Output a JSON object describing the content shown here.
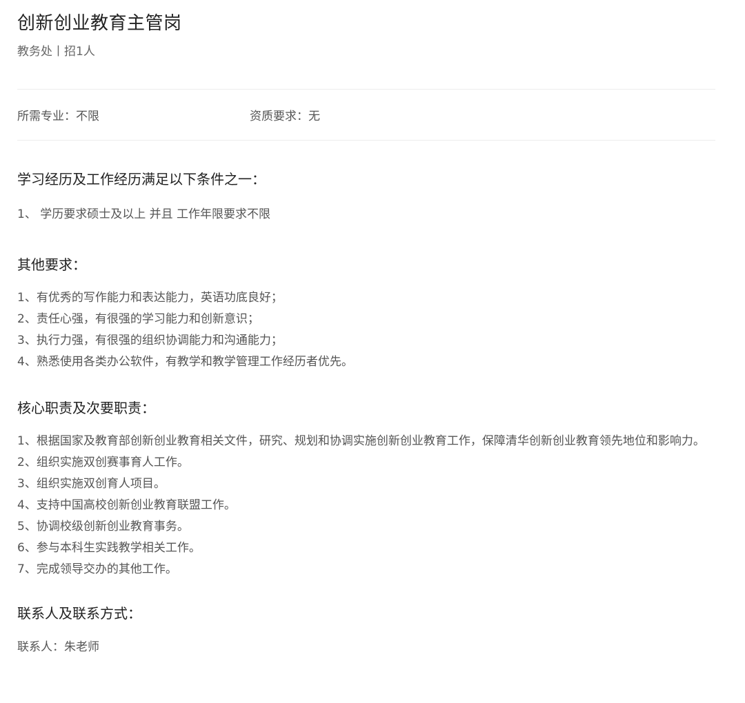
{
  "job": {
    "title": "创新创业教育主管岗",
    "meta": "教务处丨招1人"
  },
  "info": {
    "major": "所需专业：不限",
    "qualification": "资质要求：无"
  },
  "education": {
    "heading": "学习经历及工作经历满足以下条件之一：",
    "items": [
      "1、 学历要求硕士及以上 并且 工作年限要求不限"
    ]
  },
  "other": {
    "heading": "其他要求：",
    "items": [
      "1、有优秀的写作能力和表达能力，英语功底良好；",
      "2、责任心强，有很强的学习能力和创新意识；",
      "3、执行力强，有很强的组织协调能力和沟通能力；",
      "4、熟悉使用各类办公软件，有教学和教学管理工作经历者优先。"
    ]
  },
  "duties": {
    "heading": "核心职责及次要职责：",
    "items": [
      "1、根据国家及教育部创新创业教育相关文件，研究、规划和协调实施创新创业教育工作，保障清华创新创业教育领先地位和影响力。",
      "2、组织实施双创赛事育人工作。",
      "3、组织实施双创育人项目。",
      "4、支持中国高校创新创业教育联盟工作。",
      "5、协调校级创新创业教育事务。",
      "6、参与本科生实践教学相关工作。",
      "7、完成领导交办的其他工作。"
    ]
  },
  "contact": {
    "heading": "联系人及联系方式：",
    "items": [
      "联系人：朱老师"
    ]
  }
}
